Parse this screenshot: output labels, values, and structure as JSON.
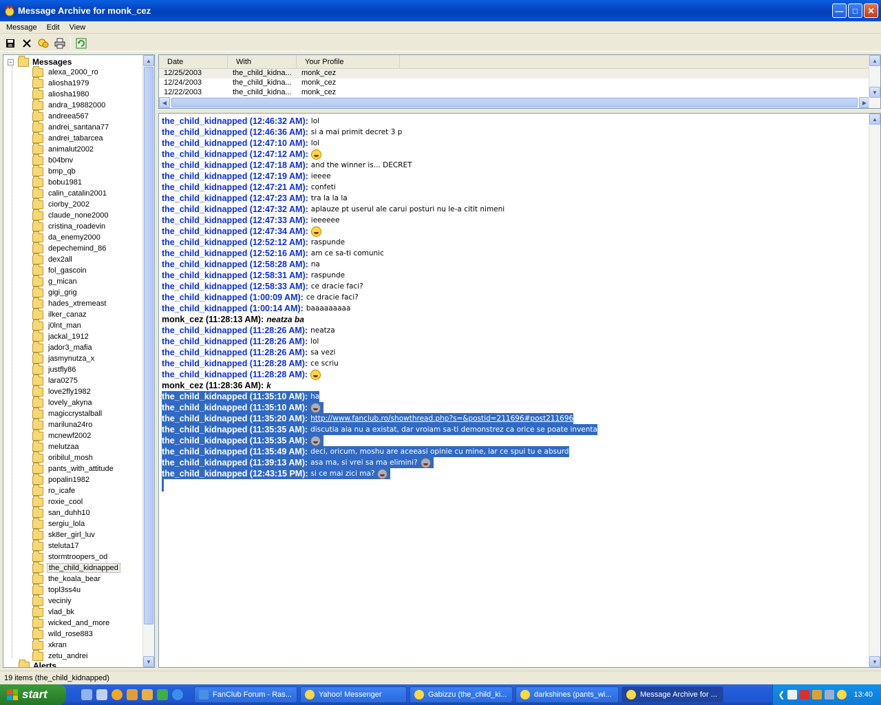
{
  "window": {
    "title": "Message Archive for monk_cez"
  },
  "menu": [
    "Message",
    "Edit",
    "View"
  ],
  "toolbar": {
    "icons": [
      "save-icon",
      "delete-icon",
      "find-icon",
      "print-icon",
      "refresh-icon"
    ]
  },
  "tree": {
    "root_label": "Messages",
    "items": [
      "alexa_2000_ro",
      "aliosha1979",
      "aliosha1980",
      "andra_19882000",
      "andreea567",
      "andrei_santana77",
      "andrei_tabarcea",
      "animalut2002",
      "b04bnv",
      "bmp_qb",
      "bobu1981",
      "calin_catalin2001",
      "ciorby_2002",
      "claude_none2000",
      "cristina_roadevin",
      "da_enemy2000",
      "depechemind_86",
      "dex2all",
      "fol_gascoin",
      "g_mican",
      "gigi_grig",
      "hades_xtremeast",
      "ilker_canaz",
      "j0lnt_man",
      "jackal_1912",
      "jador3_mafia",
      "jasmynutza_x",
      "justfly86",
      "lara0275",
      "love2fly1982",
      "lovely_akyna",
      "magiccrystalball",
      "mariluna24ro",
      "mcnewf2002",
      "melutzaa",
      "oribilul_mosh",
      "pants_with_attitude",
      "popalin1982",
      "ro_icafe",
      "roxie_cool",
      "san_duhh10",
      "sergiu_lola",
      "sk8er_girl_luv",
      "steluta17",
      "stormtroopers_od",
      "the_child_kidnapped",
      "the_koala_bear",
      "topl3ss4u",
      "veciniy",
      "vlad_bk",
      "wicked_and_more",
      "wild_rose883",
      "xkran",
      "zetu_andrei"
    ],
    "selected": "the_child_kidnapped",
    "alerts_label": "Alerts"
  },
  "message_list": {
    "columns": [
      "Date",
      "With",
      "Your Profile"
    ],
    "rows": [
      [
        "12/25/2003",
        "the_child_kidna...",
        "monk_cez"
      ],
      [
        "12/24/2003",
        "the_child_kidna...",
        "monk_cez"
      ],
      [
        "12/22/2003",
        "the_child_kidna...",
        "monk_cez"
      ]
    ]
  },
  "conversation": [
    {
      "who": "the_child_kidnapped (12:46:32 AM):",
      "text": "lol"
    },
    {
      "who": "the_child_kidnapped (12:46:36 AM):",
      "text": "si a mai primit decret 3 p"
    },
    {
      "who": "the_child_kidnapped (12:47:10 AM):",
      "text": "lol"
    },
    {
      "who": "the_child_kidnapped (12:47:12 AM):",
      "text": "",
      "emoticon": true
    },
    {
      "who": "the_child_kidnapped (12:47:18 AM):",
      "text": "and the winner is... DECRET"
    },
    {
      "who": "the_child_kidnapped (12:47:19 AM):",
      "text": "ieeee"
    },
    {
      "who": "the_child_kidnapped (12:47:21 AM):",
      "text": "confeti"
    },
    {
      "who": "the_child_kidnapped (12:47:23 AM):",
      "text": "tra la la la"
    },
    {
      "who": "the_child_kidnapped (12:47:32 AM):",
      "text": "aplauze pt userul ale carui posturi nu le-a citit nimeni"
    },
    {
      "who": "the_child_kidnapped (12:47:33 AM):",
      "text": "ieeeeee"
    },
    {
      "who": "the_child_kidnapped (12:47:34 AM):",
      "text": "",
      "emoticon": true
    },
    {
      "who": "the_child_kidnapped (12:52:12 AM):",
      "text": "raspunde"
    },
    {
      "who": "the_child_kidnapped (12:52:16 AM):",
      "text": "am ce sa-ti comunic"
    },
    {
      "who": "the_child_kidnapped (12:58:28 AM):",
      "text": "na"
    },
    {
      "who": "the_child_kidnapped (12:58:31 AM):",
      "text": "raspunde"
    },
    {
      "who": "the_child_kidnapped (12:58:33 AM):",
      "text": "ce dracie faci?"
    },
    {
      "who": "the_child_kidnapped (1:00:09 AM):",
      "text": "ce dracie faci?"
    },
    {
      "who": "the_child_kidnapped (1:00:14 AM):",
      "text": "baaaaaaaaa"
    },
    {
      "who": "monk_cez (11:28:13 AM):",
      "text": "neatza ba",
      "me": true
    },
    {
      "who": "the_child_kidnapped (11:28:26 AM):",
      "text": "neatza"
    },
    {
      "who": "the_child_kidnapped (11:28:26 AM):",
      "text": "lol"
    },
    {
      "who": "the_child_kidnapped (11:28:26 AM):",
      "text": "sa vezi"
    },
    {
      "who": "the_child_kidnapped (11:28:28 AM):",
      "text": "ce scriu"
    },
    {
      "who": "the_child_kidnapped (11:28:28 AM):",
      "text": "",
      "emoticon": true
    },
    {
      "who": "monk_cez (11:28:36 AM):",
      "text": "k",
      "me": true
    },
    {
      "who": "the_child_kidnapped (11:35:10 AM):",
      "text": "ha",
      "sel": true
    },
    {
      "who": "the_child_kidnapped (11:35:10 AM):",
      "text": "",
      "emoticon": true,
      "sel": true
    },
    {
      "who": "the_child_kidnapped (11:35:20 AM):",
      "text": "http://www.fanclub.ro/showthread.php?s=&postid=211696#post211696",
      "sel": true,
      "link": true
    },
    {
      "who": "the_child_kidnapped (11:35:35 AM):",
      "text": "discutia aia nu a existat, dar vroiam sa-ti demonstrez ca orice se poate inventa",
      "sel": true
    },
    {
      "who": "the_child_kidnapped (11:35:35 AM):",
      "text": "",
      "emoticon": true,
      "sel": true
    },
    {
      "who": "the_child_kidnapped (11:35:49 AM):",
      "text": "deci, oricum, moshu are aceeasi opinie cu mine, iar ce spui tu e absurd",
      "sel": true
    },
    {
      "who": "the_child_kidnapped (11:39:13 AM):",
      "text": "asa ma, si vrei sa ma elimini?",
      "emoticon": true,
      "sel": true
    },
    {
      "who": "the_child_kidnapped (12:43:15 PM):",
      "text": "si ce mai zici ma?",
      "emoticon": true,
      "sel": true
    }
  ],
  "status": "19 items (the_child_kidnapped)",
  "taskbar": {
    "start": "start",
    "tasks": [
      "FanClub Forum - Ras...",
      "Yahoo! Messenger",
      "Gabizzu (the_child_ki...",
      "darkshines (pants_wi...",
      "Message Archive for ..."
    ],
    "clock": "13:40"
  }
}
